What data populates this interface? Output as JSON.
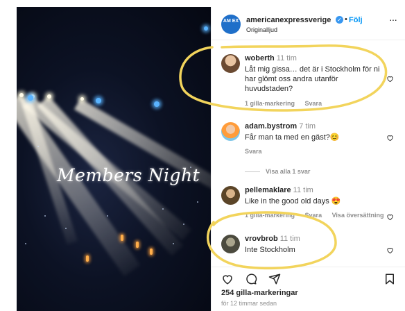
{
  "post": {
    "media_text": "Members Night",
    "account": "americanexpressverige",
    "logo_text": "AM EX",
    "follow_label": "Följ",
    "audio_label": "Originalljud",
    "more_label": "···",
    "likes": "254 gilla-markeringar",
    "posted": "för 12 timmar sedan"
  },
  "comments": [
    {
      "user": "woberth",
      "time": "11 tim",
      "text": "Låt mig gissa… det är i Stockholm för ni har glömt oss andra utanför huvudstaden?",
      "likes": "1 gilla-markering",
      "reply": "Svara"
    },
    {
      "user": "adam.bystrom",
      "time": "7 tim",
      "text": "Får man ta med en gäst?😊",
      "reply": "Svara",
      "view_replies": "Visa alla 1 svar"
    },
    {
      "user": "pellemaklare",
      "time": "11 tim",
      "text": "Like in the good old days 😍",
      "likes": "1 gilla-markering",
      "reply": "Svara",
      "translate": "Visa översättning"
    },
    {
      "user": "vrovbrob",
      "time": "11 tim",
      "text": "Inte Stockholm"
    }
  ],
  "colors": {
    "accent": "#0095f6",
    "highlight": "#f2d45c",
    "logo": "#1f6fc9"
  }
}
